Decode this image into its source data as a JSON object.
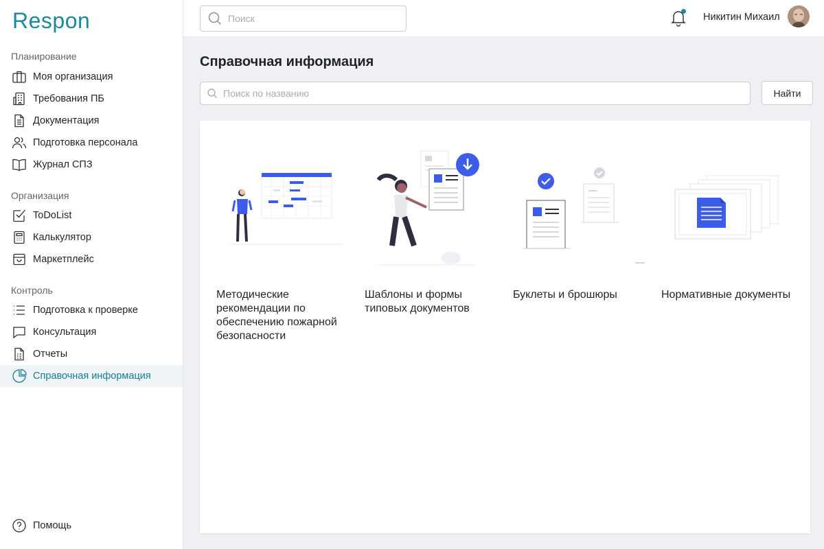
{
  "brand": {
    "logo_text": "Respon",
    "accent": "#1a8a9a",
    "accent_dark": "#1a7d8c",
    "illustration_blue": "#3d5ce8"
  },
  "header": {
    "search_placeholder": "Поиск",
    "user_name": "Никитин Михаил",
    "notification_icon": "bell-icon"
  },
  "sidebar": {
    "groups": [
      {
        "title": "Планирование",
        "items": [
          {
            "label": "Моя организация",
            "icon": "briefcase-icon"
          },
          {
            "label": "Требования ПБ",
            "icon": "building-icon"
          },
          {
            "label": "Документация",
            "icon": "document-icon"
          },
          {
            "label": "Подготовка персонала",
            "icon": "users-icon"
          },
          {
            "label": "Журнал СПЗ",
            "icon": "book-icon"
          }
        ]
      },
      {
        "title": "Организация",
        "items": [
          {
            "label": "ToDoList",
            "icon": "checkbox-icon"
          },
          {
            "label": "Калькулятор",
            "icon": "calculator-icon"
          },
          {
            "label": "Маркетплейс",
            "icon": "bag-icon"
          }
        ]
      },
      {
        "title": "Контроль",
        "items": [
          {
            "label": "Подготовка к проверке",
            "icon": "list-icon"
          },
          {
            "label": "Консультация",
            "icon": "chat-icon"
          },
          {
            "label": "Отчеты",
            "icon": "report-icon"
          },
          {
            "label": "Справочная информация",
            "icon": "pie-chart-icon",
            "active": true
          }
        ]
      }
    ],
    "help": {
      "label": "Помощь",
      "icon": "question-icon"
    }
  },
  "main": {
    "title": "Справочная информация",
    "search_placeholder": "Поиск по названию",
    "find_button": "Найти",
    "cards": [
      {
        "title": "Методические рекомендации по обеспечению пожарной безопасности"
      },
      {
        "title": "Шаблоны и формы типовых документов"
      },
      {
        "title": "Буклеты и брошюры"
      },
      {
        "title": "Нормативные документы"
      }
    ]
  }
}
